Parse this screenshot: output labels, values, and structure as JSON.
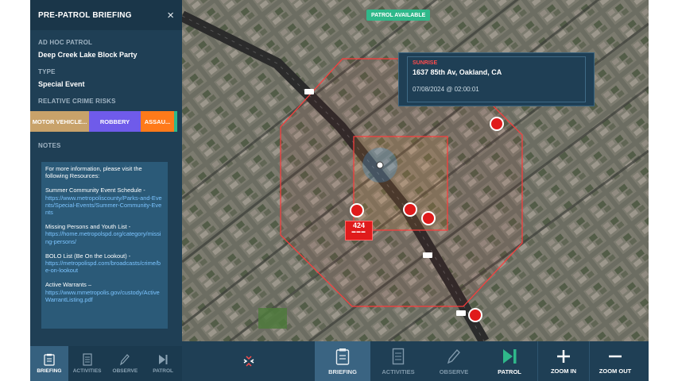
{
  "panel": {
    "title": "PRE-PATROL BRIEFING",
    "close_symbol": "×",
    "patrol_label": "AD HOC PATROL",
    "patrol_value": "Deep Creek Lake Block Party",
    "type_label": "TYPE",
    "type_value": "Special Event",
    "risks_label": "RELATIVE CRIME RISKS",
    "risks": [
      {
        "label": "MOTOR VEHICLE...",
        "color": "#c8a26a"
      },
      {
        "label": "ROBBERY",
        "color": "#6f5bea"
      },
      {
        "label": "ASSAU...",
        "color": "#ff7a1a"
      }
    ],
    "notes_label": "NOTES",
    "notes": {
      "intro": "For more information, please visit the following Resources:",
      "items": [
        {
          "title": "Summer Community Event Schedule -",
          "link": "https://www.metropoliscounty/Parks-and-Events/Special-Events/Summer-Community-Events"
        },
        {
          "title": "Missing Persons and Youth List -",
          "link": "https://home.metropolspd.org/category/missing-persons/"
        },
        {
          "title": "BOLO List (Be On the Lookout) -",
          "link": "https://metropolispd.com/broadcasts/crime/be-on-lookout"
        },
        {
          "title": "Active Warrants –",
          "link": "https://www.mmetropolis.gov/custody/ActiveWarrantListing.pdf"
        }
      ]
    },
    "tabs": [
      {
        "label": "BRIEFING",
        "icon": "clipboard-icon"
      },
      {
        "label": "ACTIVITIES",
        "icon": "checklist-icon"
      },
      {
        "label": "OBSERVE",
        "icon": "pencil-icon"
      },
      {
        "label": "PATROL",
        "icon": "play-icon"
      }
    ]
  },
  "map": {
    "badge": "PATROL AVAILABLE",
    "info": {
      "subtitle": "SUNRISE",
      "address": "1637 85th Av, Oakland, CA",
      "datetime": "07/08/2024 @ 02:00:01"
    },
    "unit_number": "424",
    "unit_bars": "▬▬▬",
    "road_labels": [
      "185",
      "185",
      "185"
    ]
  },
  "toolbar": {
    "buttons": [
      {
        "label": "BRIEFING",
        "icon": "clipboard-icon"
      },
      {
        "label": "ACTIVITIES",
        "icon": "checklist-icon"
      },
      {
        "label": "OBSERVE",
        "icon": "pencil-icon"
      },
      {
        "label": "PATROL",
        "icon": "play-icon"
      },
      {
        "label": "ZOOM IN",
        "icon": "plus-icon"
      },
      {
        "label": "ZOOM OUT",
        "icon": "minus-icon"
      }
    ],
    "collapse_icon": "collapse-arrows-icon"
  },
  "colors": {
    "panel_bg": "#1f3f55",
    "accent_red": "#e01b1b",
    "badge_green": "#2fb88a",
    "link_blue": "#7cc4ff"
  }
}
